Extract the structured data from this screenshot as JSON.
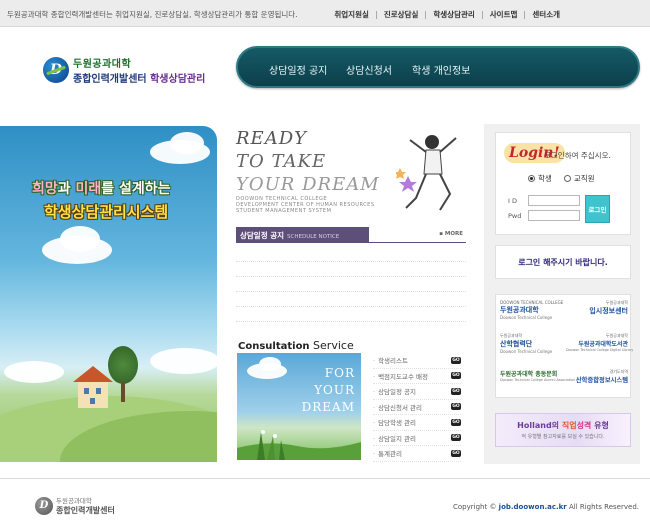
{
  "topbar": {
    "intro": "두원공과대학 종합인력개발센터는 취업지원실, 진로상담실, 학생상담관리가 통합 운영됩니다.",
    "links": [
      "취업지원실",
      "진로상담실",
      "학생상담관리",
      "사이트맵",
      "센터소개"
    ]
  },
  "logo": {
    "mark": "D",
    "line1": "두원공과대학",
    "line2_main": "종합인력개발센터",
    "line2_sub": "학생상담관리"
  },
  "mainnav": [
    "상담일정 공지",
    "상담신청서",
    "학생 개인정보"
  ],
  "hero": {
    "line1_a": "희망",
    "line1_b": "과 ",
    "line1_c": "미래",
    "line1_d": "를 설계하는",
    "line2": "학생상담관리시스템"
  },
  "ready": {
    "l1": "READY",
    "l2": "TO TAKE",
    "l3": "YOUR DREAM",
    "s1": "DOOWON TECHNICAL COLLEGE",
    "s2": "DEVELOPMENT CENTER OF HUMAN RESOURCES",
    "s3": "STUDENT MANAGEMENT SYSTEM"
  },
  "notice": {
    "title": "상담일정 공지",
    "title_en": "SCHEDULE NOTICE",
    "more": "MORE"
  },
  "consult": {
    "title_en_bold": "Consultation",
    "title_en": " Service",
    "image_text": [
      "FOR",
      "YOUR",
      "DREAM"
    ],
    "go_label": "GO",
    "items": [
      "학생리스트",
      "백점지도교수 배정",
      "상담일정 공지",
      "상담신청서 관리",
      "담당학생 관리",
      "상담일지 관리",
      "통계관리"
    ]
  },
  "login": {
    "badge": "Login!",
    "message": "로그인하여 주십시오.",
    "radio_student": "학생",
    "radio_staff": "교직원",
    "id_label": "I D",
    "pw_label": "Pwd",
    "button": "로그인",
    "warning": "로그인 해주시기 바랍니다."
  },
  "banners": [
    {
      "a": "DOOWON TECHNICAL COLLEGE",
      "b": "두원공과대학",
      "c": "Doowon Technical College"
    },
    {
      "a": "두원공과대학",
      "b": "입시정보센터",
      "c": ""
    },
    {
      "a": "두원공과대학",
      "b": "산학협력단",
      "c": "Doowon Technical College"
    },
    {
      "a": "두원공과대학",
      "b": "두원공과대학도서관",
      "c": "Doowon Technical College Digital Library"
    },
    {
      "a": "",
      "b": "두원공과대학 총동문회",
      "c": "Doowon Technical College Alumni Association"
    },
    {
      "a": "경기도지역",
      "b": "산학중합정보시스템",
      "c": ""
    }
  ],
  "holland": {
    "word": "Holland",
    "mid": "의 ",
    "k1": "직업",
    "k2": "성격",
    "tail": " 유형",
    "sub": "적 유형별 참고자료를 보실 수 있습니다."
  },
  "footer": {
    "line1": "두원공과대학",
    "line2": "종합인력개발센터",
    "copy_pre": "Copyright © ",
    "site": "job.doowon.ac.kr",
    "copy_post": " All Rights Reserved."
  }
}
